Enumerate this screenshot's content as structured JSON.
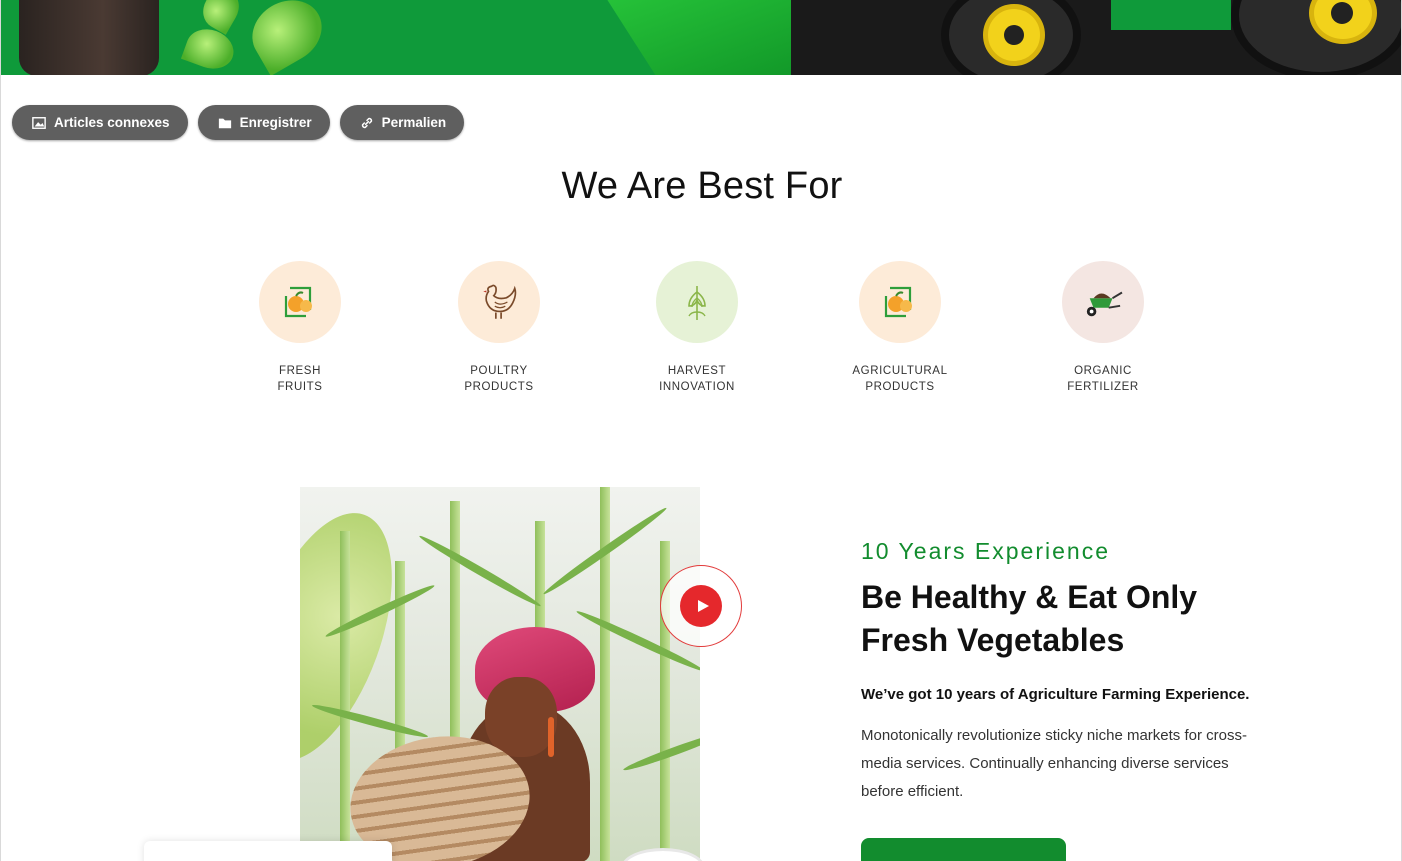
{
  "hero": {
    "accent": "#0f9a3a"
  },
  "actions": [
    {
      "label": "Articles connexes",
      "icon": "image-icon"
    },
    {
      "label": "Enregistrer",
      "icon": "folder-icon"
    },
    {
      "label": "Permalien",
      "icon": "link-icon"
    }
  ],
  "section": {
    "title": "We Are Best For"
  },
  "features": [
    {
      "label": "FRESH\nFRUITS",
      "icon": "fruit-basket-icon",
      "bg": "#fdebd8"
    },
    {
      "label": "POULTRY\nPRODUCTS",
      "icon": "hen-icon",
      "bg": "#fdebd8"
    },
    {
      "label": "HARVEST\nINNOVATION",
      "icon": "wheat-icon",
      "bg": "#e6f2d6"
    },
    {
      "label": "AGRICULTURAL\nPRODUCTS",
      "icon": "fruit-basket-icon",
      "bg": "#fdebd8"
    },
    {
      "label": "ORGANIC\nFERTILIZER",
      "icon": "wheelbarrow-icon",
      "bg": "#f4e6e2"
    }
  ],
  "about": {
    "subtitle": "10 Years Experience",
    "headline": "Be Healthy & Eat Only Fresh Vegetables",
    "lead": "We’ve got 10 years of Agriculture Farming Experience.",
    "body": "Monotonically revolutionize sticky niche markets for cross-media services. Continually enhancing diverse services before efficient.",
    "accent": "#128c2e",
    "play_color": "#e5282c"
  }
}
